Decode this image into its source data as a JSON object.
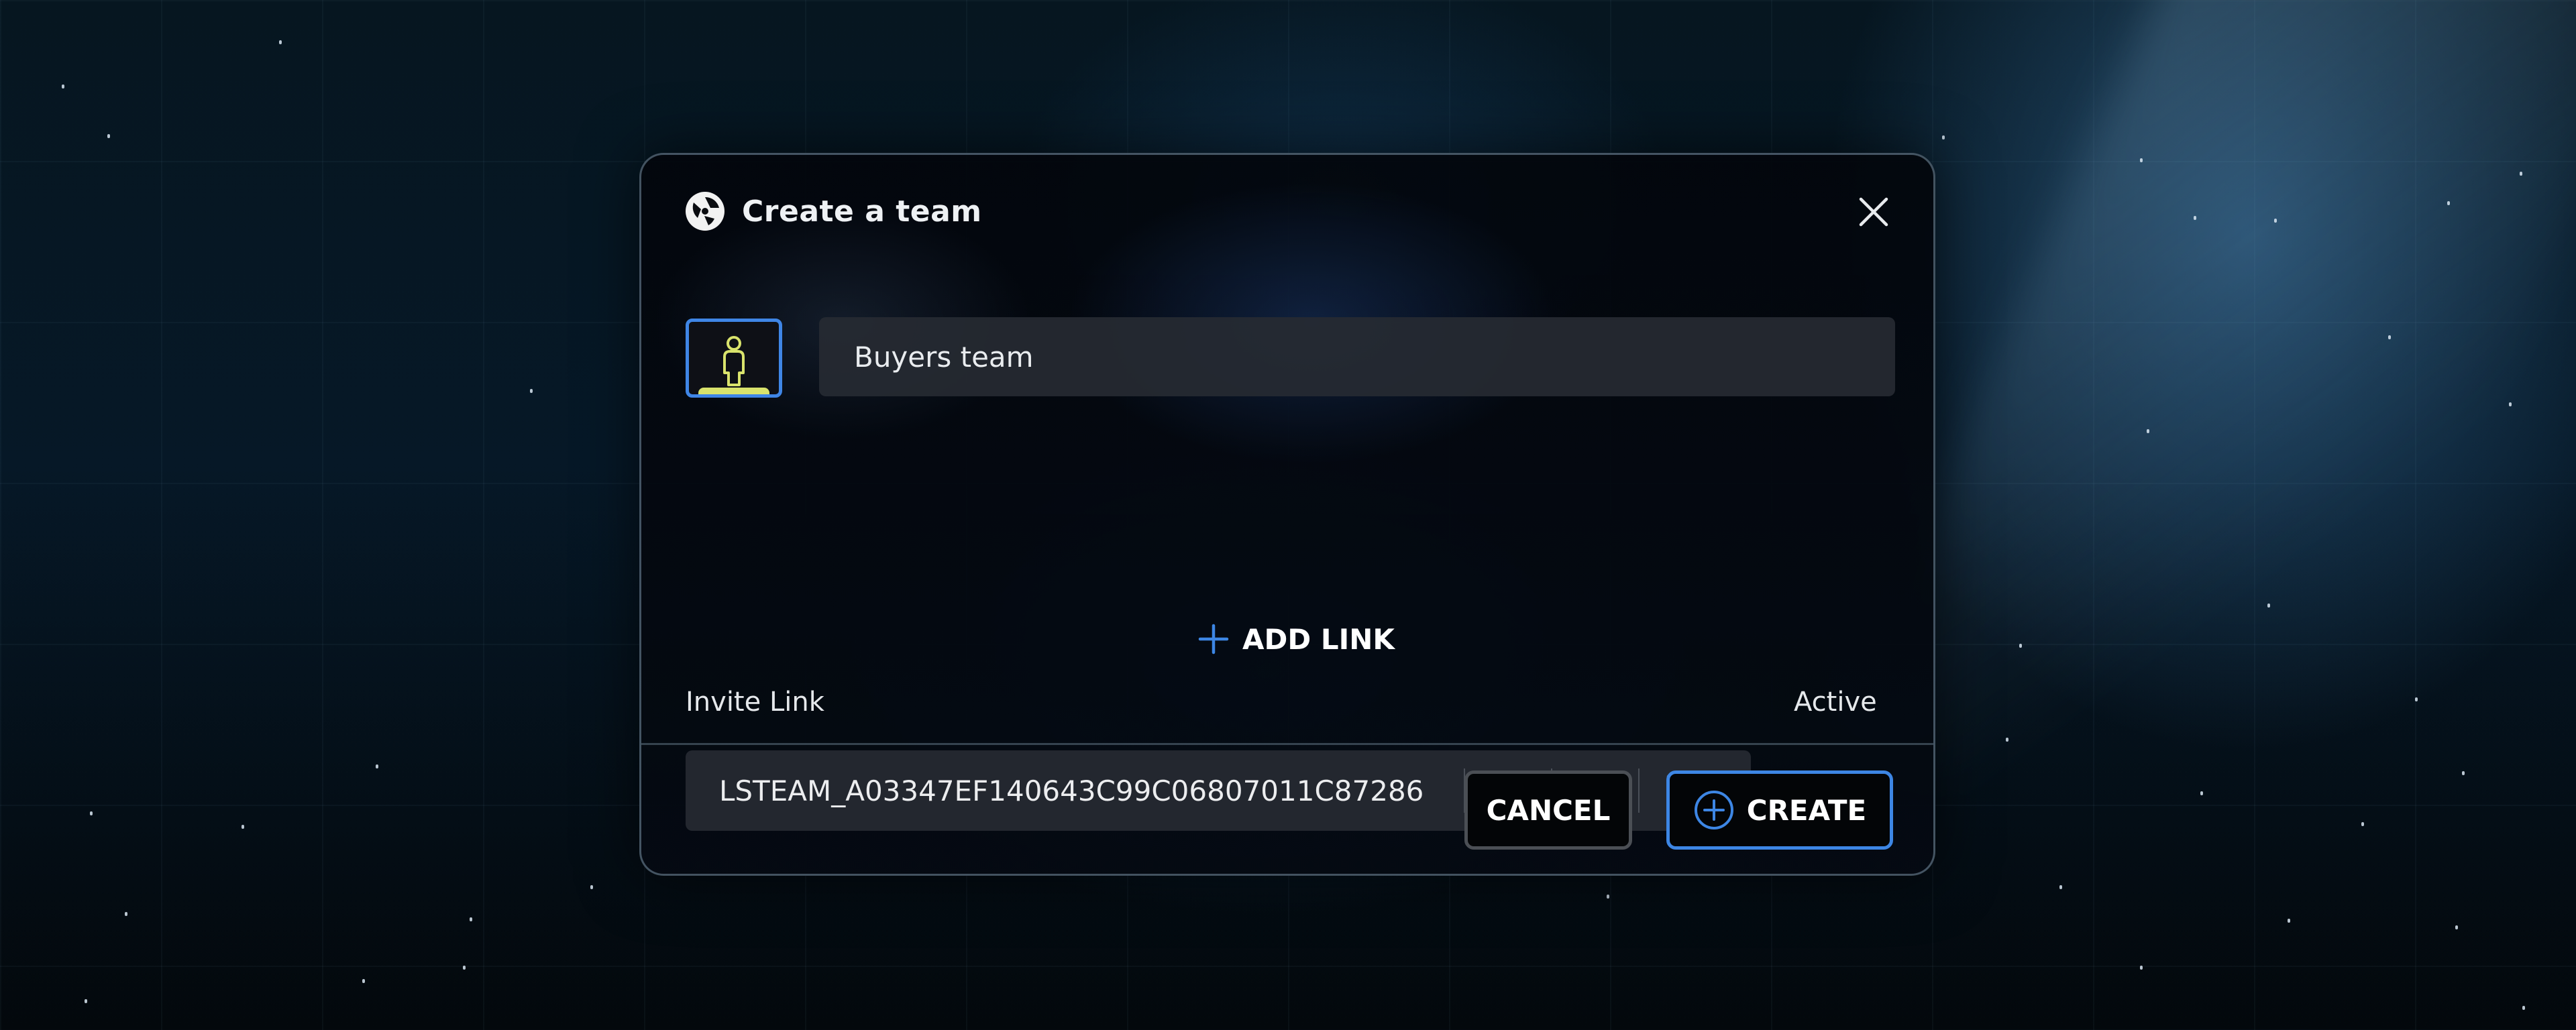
{
  "dialog": {
    "title": "Create a team",
    "logo_icon": "aperture-logo-icon",
    "close_icon": "close-icon"
  },
  "team": {
    "avatar_icon": "person-icon",
    "avatar_color": "#d9e36c",
    "name_value": "Buyers team"
  },
  "add_link": {
    "label": "ADD LINK",
    "icon": "plus-icon"
  },
  "invite": {
    "label": "Invite Link",
    "active_label": "Active",
    "link_value": "LSTEAM_A03347EF140643C99C06807011C87286",
    "active": true,
    "actions": [
      "copy-icon",
      "edit-icon",
      "delete-icon"
    ]
  },
  "footer": {
    "cancel_label": "CANCEL",
    "create_label": "CREATE",
    "create_icon": "plus-circle-icon"
  },
  "colors": {
    "accent": "#3d86e4",
    "avatar_accent": "#d9e36c",
    "input_bg": "#262a32"
  }
}
